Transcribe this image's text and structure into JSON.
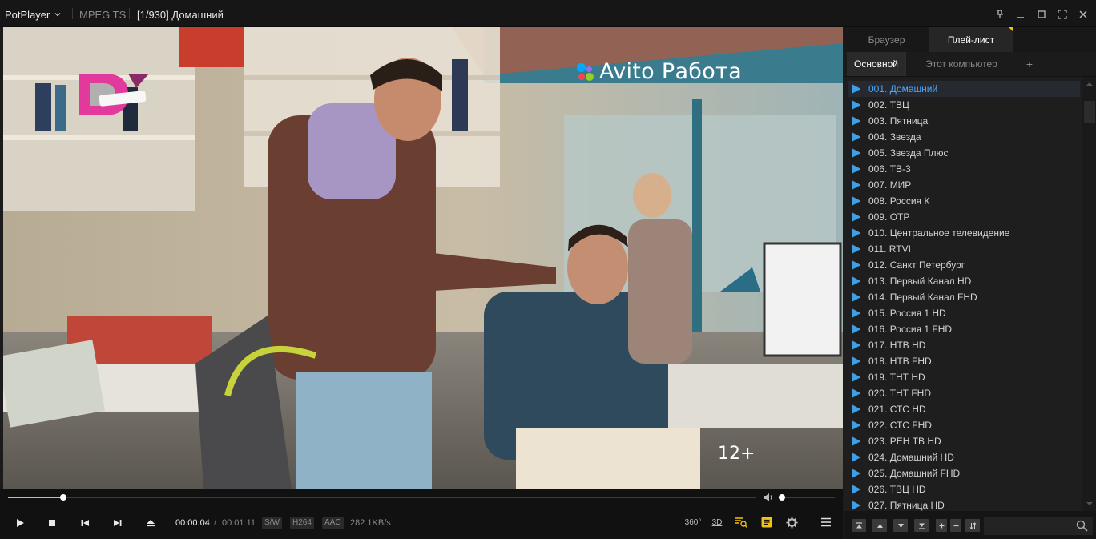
{
  "titlebar": {
    "app_name": "PotPlayer",
    "format": "MPEG TS",
    "title": "[1/930] Домашний",
    "controls": [
      "pin-icon",
      "minimize-icon",
      "maximize-icon",
      "fullscreen-icon",
      "close-icon"
    ]
  },
  "video": {
    "brand_text": "Avito Работа",
    "age_rating": "12+"
  },
  "seek": {
    "position_fraction": 0.074,
    "volume_fraction": 0.06
  },
  "controls": {
    "time_current": "00:00:04",
    "time_separator": "/",
    "time_duration": "00:01:11",
    "tag_sw": "S/W",
    "tag_video_codec": "H264",
    "tag_audio_codec": "AAC",
    "bitrate": "282.1KB/s",
    "btn_360": "360°",
    "btn_3d": "3D"
  },
  "panel": {
    "tab_browser": "Браузер",
    "tab_playlist": "Плей-лист",
    "sub_main": "Основной",
    "sub_pc": "Этот компьютер",
    "sub_add": "+",
    "items": [
      "001. Домашний",
      "002. ТВЦ",
      "003. Пятница",
      "004. Звезда",
      "005. Звезда Плюс",
      "006. ТВ-3",
      "007. МИР",
      "008. Россия К",
      "009. ОТР",
      "010. Центральное телевидение",
      "011. RTVI",
      "012. Санкт Петербург",
      "013. Первый Канал HD",
      "014. Первый Канал FHD",
      "015. Россия 1 HD",
      "016. Россия 1 FHD",
      "017. НТВ HD",
      "018. НТВ FHD",
      "019. ТНТ HD",
      "020. ТНТ FHD",
      "021. СТС HD",
      "022. СТС FHD",
      "023. РЕН ТВ HD",
      "024. Домашний HD",
      "025. Домашний FHD",
      "026. ТВЦ HD",
      "027. Пятница HD"
    ]
  },
  "colors": {
    "accent": "#f4c20d",
    "active_item": "#4aa6ff",
    "play_icon": "#3d9fe8"
  }
}
